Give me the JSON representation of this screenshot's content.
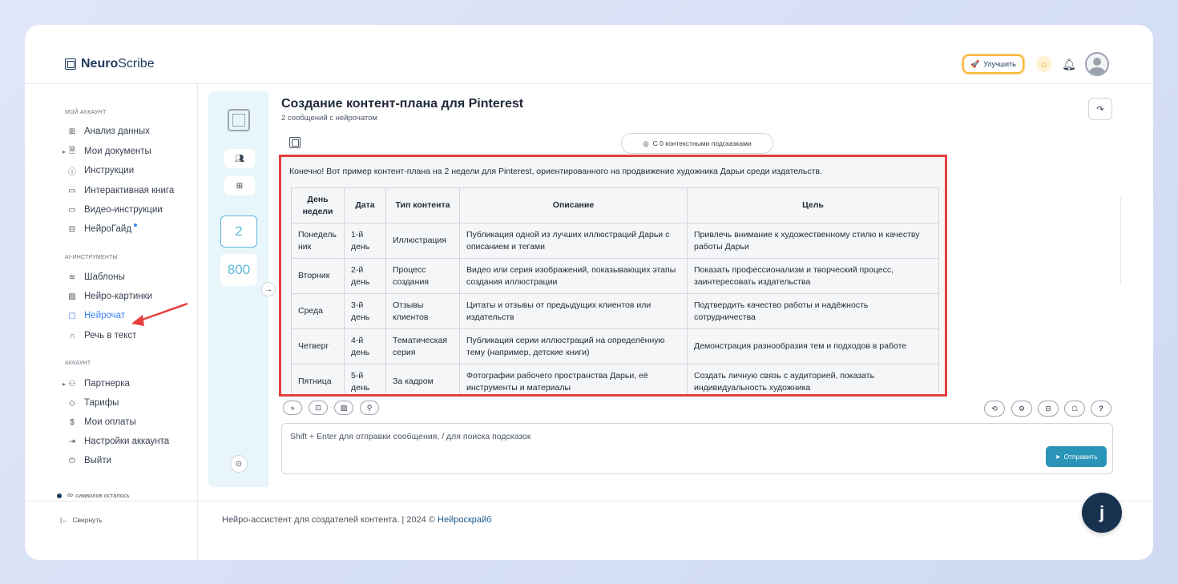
{
  "app": {
    "logo_strong": "Neuro",
    "logo_rest": "Scribe"
  },
  "header": {
    "upgrade_label": "Улучшить"
  },
  "sidebar": {
    "sections": {
      "account": "МОЙ АККАУНТ",
      "ai_tools": "AI-ИНСТРУМЕНТЫ",
      "account2": "АККАУНТ"
    },
    "items": [
      {
        "label": "Анализ данных",
        "icon": "grid-icon"
      },
      {
        "label": "Мои документы",
        "icon": "document-icon"
      },
      {
        "label": "Инструкции",
        "icon": "help-circle-icon"
      },
      {
        "label": "Интерактивная книга",
        "icon": "book-icon"
      },
      {
        "label": "Видео-инструкции",
        "icon": "video-icon"
      },
      {
        "label": "НейроГайд",
        "icon": "layout-icon"
      },
      {
        "label": "Шаблоны",
        "icon": "layers-icon"
      },
      {
        "label": "Нейро-картинки",
        "icon": "image-icon"
      },
      {
        "label": "Нейрочат",
        "icon": "chat-icon"
      },
      {
        "label": "Речь в текст",
        "icon": "headphones-icon"
      },
      {
        "label": "Партнерка",
        "icon": "users-icon"
      },
      {
        "label": "Тарифы",
        "icon": "tag-icon"
      },
      {
        "label": "Мои оплаты",
        "icon": "dollar-icon"
      },
      {
        "label": "Настройки аккаунта",
        "icon": "login-icon"
      },
      {
        "label": "Выйти",
        "icon": "power-icon"
      }
    ],
    "chars_left_symbol": "∞",
    "chars_left_text": "символов осталось",
    "collapse_label": "Свернуть"
  },
  "tools": {
    "count_messages": "2",
    "count_tokens": "800"
  },
  "chat": {
    "title": "Создание контент-плана для Pinterest",
    "subtitle": "2 сообщений с нейрочатом",
    "context_label": "С 0 контекстными подсказками",
    "intro": "Конечно! Вот пример контент-плана на 2 недели для Pinterest, ориентированного на продвижение художника Дарьи среди издательств.",
    "table": {
      "headers": [
        "День недели",
        "Дата",
        "Тип контента",
        "Описание",
        "Цель"
      ],
      "rows": [
        [
          "Понедельник",
          "1-й день",
          "Иллюстрация",
          "Публикация одной из лучших иллюстраций Дарьи с описанием и тегами",
          "Привлечь внимание к художественному стилю и качеству работы Дарьи"
        ],
        [
          "Вторник",
          "2-й день",
          "Процесс создания",
          "Видео или серия изображений, показывающих этапы создания иллюстрации",
          "Показать профессионализм и творческий процесс, заинтересовать издательства"
        ],
        [
          "Среда",
          "3-й день",
          "Отзывы клиентов",
          "Цитаты и отзывы от предыдущих клиентов или издательств",
          "Подтвердить качество работы и надёжность сотрудничества"
        ],
        [
          "Четверг",
          "4-й день",
          "Тематическая серия",
          "Публикация серии иллюстраций на определённую тему (например, детские книги)",
          "Демонстрация разнообразия тем и подходов в работе"
        ],
        [
          "Пятница",
          "5-й день",
          "За кадром",
          "Фотографии рабочего пространства Дарьи, её инструменты и материалы",
          "Создать личную связь с аудиторией, показать индивидуальность художника"
        ]
      ]
    },
    "input_placeholder": "Shift + Enter для отправки сообщения, / для поиска подсказок",
    "send_label": "Отправить"
  },
  "footer": {
    "text": "Нейро-ассистент для создателей контента.  | 2024 © ",
    "link": "Нейроскрайб"
  },
  "fab": {
    "label": "j"
  }
}
